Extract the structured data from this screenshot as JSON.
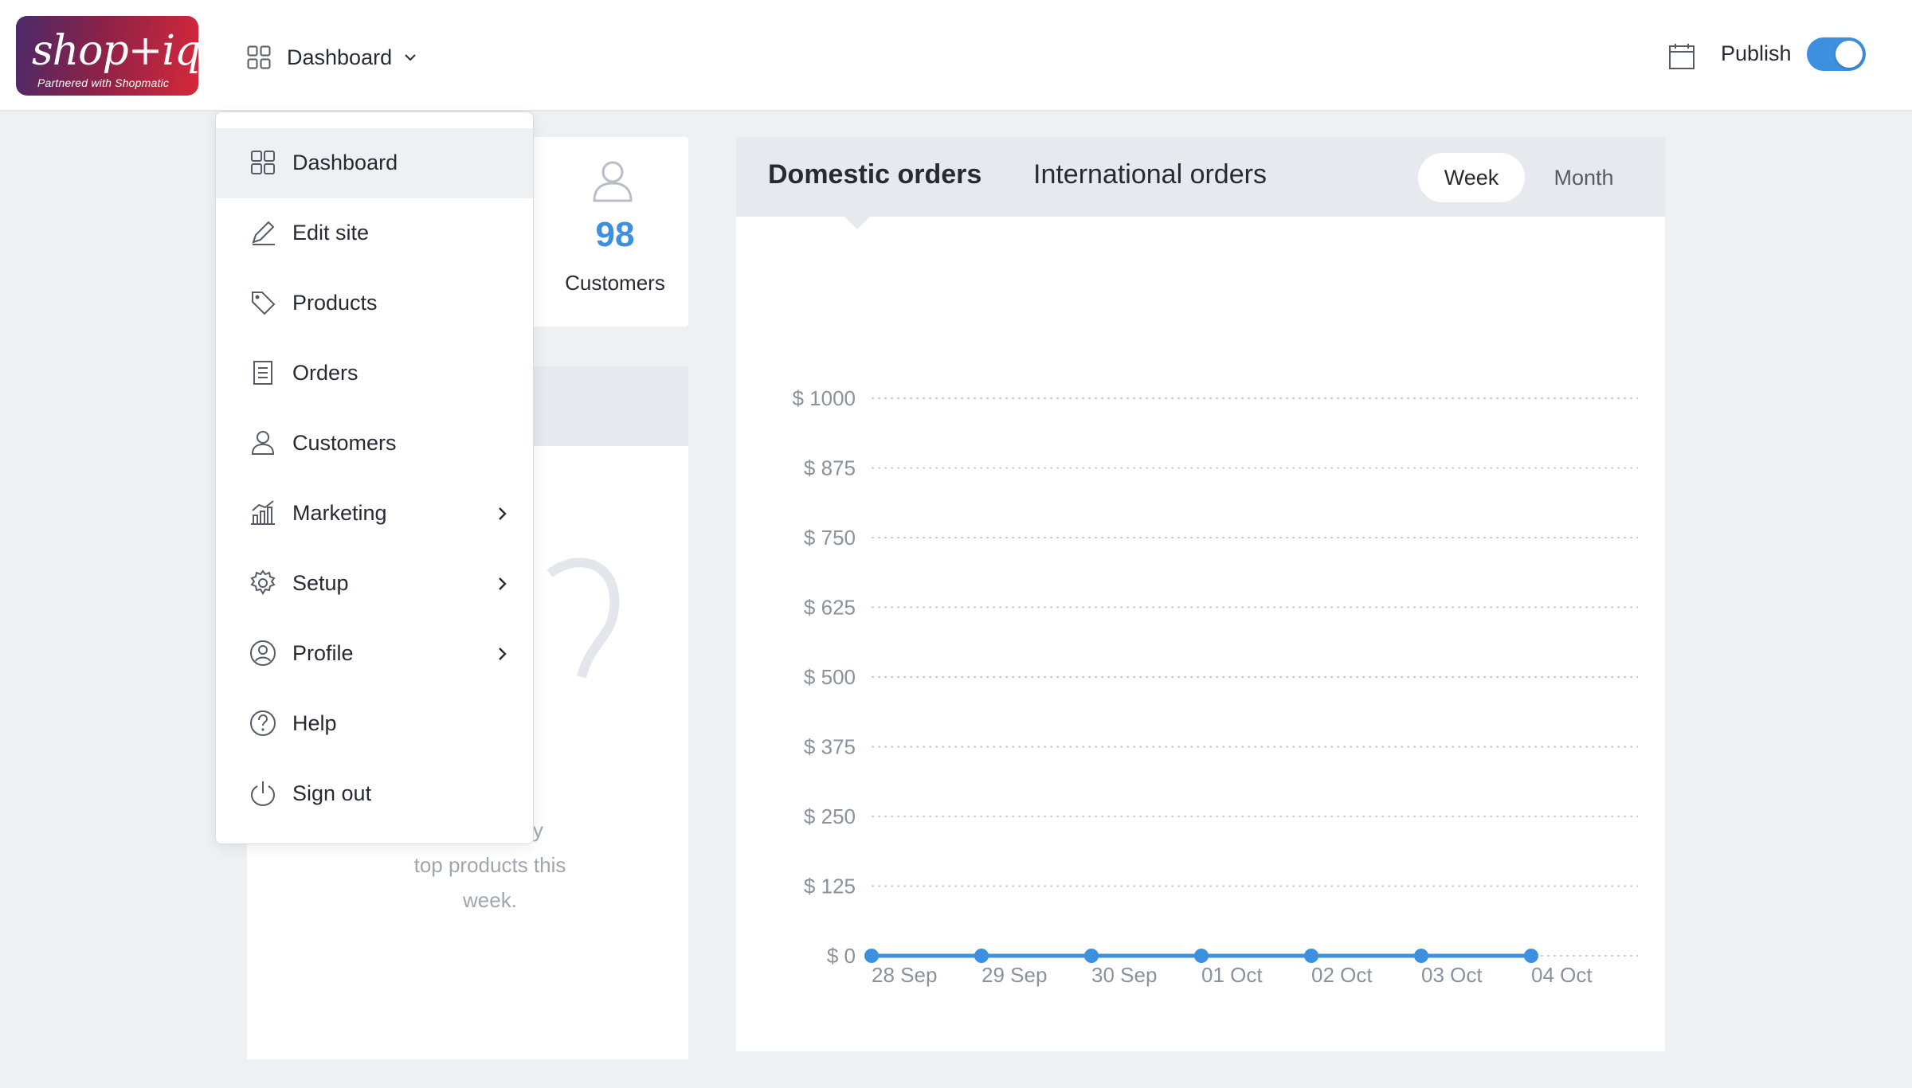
{
  "header": {
    "logo_text": "shop+iq",
    "logo_subtitle": "Partnered with Shopmatic",
    "nav_label": "Dashboard",
    "publish_label": "Publish",
    "publish_enabled": true
  },
  "menu": {
    "items": [
      {
        "label": "Dashboard",
        "icon": "dashboard-grid-icon",
        "active": true,
        "has_submenu": false
      },
      {
        "label": "Edit site",
        "icon": "pencil-icon",
        "active": false,
        "has_submenu": false
      },
      {
        "label": "Products",
        "icon": "tag-icon",
        "active": false,
        "has_submenu": false
      },
      {
        "label": "Orders",
        "icon": "document-icon",
        "active": false,
        "has_submenu": false
      },
      {
        "label": "Customers",
        "icon": "user-icon",
        "active": false,
        "has_submenu": false
      },
      {
        "label": "Marketing",
        "icon": "chart-bars-icon",
        "active": false,
        "has_submenu": true
      },
      {
        "label": "Setup",
        "icon": "gear-icon",
        "active": false,
        "has_submenu": true
      },
      {
        "label": "Profile",
        "icon": "user-circle-icon",
        "active": false,
        "has_submenu": true
      },
      {
        "label": "Help",
        "icon": "question-circle-icon",
        "active": false,
        "has_submenu": false
      },
      {
        "label": "Sign out",
        "icon": "power-icon",
        "active": false,
        "has_submenu": false
      }
    ]
  },
  "stats": {
    "customers_value": "98",
    "customers_label": "Customers"
  },
  "top_products": {
    "empty_message_line1": "any",
    "empty_message_line2": "top products this",
    "empty_message_line3": "week."
  },
  "orders": {
    "tabs": [
      "Domestic orders",
      "International orders"
    ],
    "active_tab": "Domestic orders",
    "periods": [
      "Week",
      "Month"
    ],
    "active_period": "Week"
  },
  "colors": {
    "accent": "#3d8fe0",
    "background": "#eef1f4",
    "panel_header": "#e6eaee"
  },
  "chart_data": {
    "type": "line",
    "categories": [
      "28 Sep",
      "29 Sep",
      "30 Sep",
      "01 Oct",
      "02 Oct",
      "03 Oct",
      "04 Oct"
    ],
    "series": [
      {
        "values": [
          0,
          0,
          0,
          0,
          0,
          0,
          0
        ]
      }
    ],
    "y_ticks": [
      "$ 0",
      "$ 125",
      "$ 250",
      "$ 375",
      "$ 500",
      "$ 625",
      "$ 750",
      "$ 875",
      "$ 1000"
    ],
    "ylim": [
      0,
      1000
    ],
    "grid": true
  }
}
